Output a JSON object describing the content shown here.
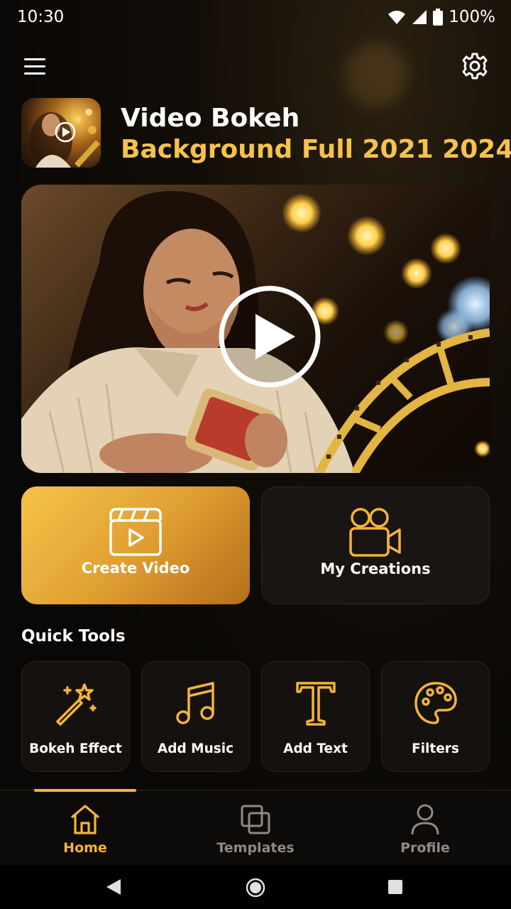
{
  "status_bar": {
    "time": "10:30",
    "battery": "100%"
  },
  "header": {
    "title_line1": "Video Bokeh",
    "title_line2": "Background Full 2021 2024"
  },
  "actions": [
    {
      "label": "Create Video",
      "icon": "clapperboard-icon"
    },
    {
      "label": "My Creations",
      "icon": "video-camera-icon"
    }
  ],
  "quick_tools": {
    "title": "Quick Tools",
    "items": [
      {
        "label": "Bokeh Effect",
        "icon": "magic-wand-icon"
      },
      {
        "label": "Add Music",
        "icon": "music-note-icon"
      },
      {
        "label": "Add Text",
        "icon": "text-icon"
      },
      {
        "label": "Filters",
        "icon": "palette-icon"
      }
    ]
  },
  "bottom_nav": {
    "items": [
      {
        "label": "Home",
        "icon": "home-icon",
        "active": true
      },
      {
        "label": "Templates",
        "icon": "templates-icon",
        "active": false
      },
      {
        "label": "Profile",
        "icon": "profile-icon",
        "active": false
      }
    ]
  },
  "colors": {
    "accent": "#f3b43b",
    "gold_title": "#f6c24c",
    "background": "#0a0806",
    "inactive": "#8f8a85"
  }
}
